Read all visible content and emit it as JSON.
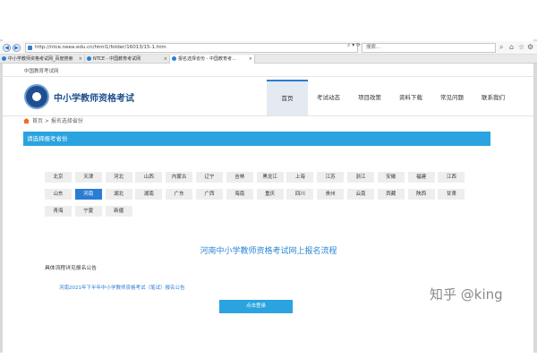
{
  "browser": {
    "url": "http://ntce.neea.edu.cn/html1/folder/16013/15-1.htm",
    "url_tools": "⌕ ▾ ⟳",
    "search_placeholder": "搜索...",
    "tabs": [
      {
        "label": "中小学教师资格考试网_百度搜索",
        "close": "×"
      },
      {
        "label": "NTCE - 中国教育考试网",
        "close": "×"
      },
      {
        "label": "报名选择省份 - 中国教育考...",
        "close": "×"
      }
    ]
  },
  "site": {
    "top_link": "中国教育考试网",
    "title": "中小学教师资格考试",
    "nav": [
      "首页",
      "考试动态",
      "项目政策",
      "资料下载",
      "常见问题",
      "联系我们"
    ],
    "breadcrumb": "首页 > 报名选择省份",
    "section_title": "请选择报考省份",
    "provinces": [
      [
        "北京",
        "天津",
        "河北",
        "山西",
        "内蒙古",
        "辽宁",
        "吉林",
        "黑龙江",
        "上海",
        "江苏",
        "浙江",
        "安徽",
        "福建",
        "江西"
      ],
      [
        "山东",
        "河南",
        "湖北",
        "湖南",
        "广东",
        "广西",
        "海南",
        "重庆",
        "四川",
        "贵州",
        "云南",
        "西藏",
        "陕西",
        "甘肃"
      ],
      [
        "青海",
        "宁夏",
        "新疆"
      ]
    ],
    "selected_province": "河南",
    "flow_title": "河南中小学教师资格考试网上报名流程",
    "flow_subtitle": "具体流程详见报名公告",
    "notice_link": "河南2021年下半年中小学教师资格考试（笔试）报名公告",
    "login_button": "点击登录"
  },
  "watermark": "知乎 @king",
  "colors": {
    "accent": "#2aa3e0",
    "selected": "#2b7cd3",
    "flow_title": "#2b86d6"
  }
}
